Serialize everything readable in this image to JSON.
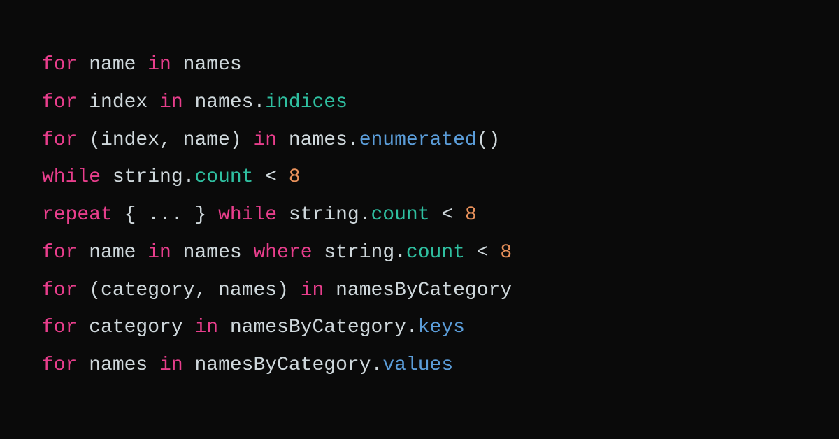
{
  "code": {
    "lines": [
      [
        {
          "cls": "k",
          "t": "for"
        },
        {
          "cls": "d",
          "t": " name "
        },
        {
          "cls": "k",
          "t": "in"
        },
        {
          "cls": "d",
          "t": " names"
        }
      ],
      [
        {
          "cls": "k",
          "t": "for"
        },
        {
          "cls": "d",
          "t": " index "
        },
        {
          "cls": "k",
          "t": "in"
        },
        {
          "cls": "d",
          "t": " names."
        },
        {
          "cls": "p",
          "t": "indices"
        }
      ],
      [
        {
          "cls": "k",
          "t": "for"
        },
        {
          "cls": "d",
          "t": " (index, name) "
        },
        {
          "cls": "k",
          "t": "in"
        },
        {
          "cls": "d",
          "t": " names."
        },
        {
          "cls": "m",
          "t": "enumerated"
        },
        {
          "cls": "d",
          "t": "()"
        }
      ],
      [
        {
          "cls": "k",
          "t": "while"
        },
        {
          "cls": "d",
          "t": " string."
        },
        {
          "cls": "p",
          "t": "count"
        },
        {
          "cls": "d",
          "t": " < "
        },
        {
          "cls": "n",
          "t": "8"
        }
      ],
      [
        {
          "cls": "k",
          "t": "repeat"
        },
        {
          "cls": "d",
          "t": " { ... } "
        },
        {
          "cls": "k",
          "t": "while"
        },
        {
          "cls": "d",
          "t": " string."
        },
        {
          "cls": "p",
          "t": "count"
        },
        {
          "cls": "d",
          "t": " < "
        },
        {
          "cls": "n",
          "t": "8"
        }
      ],
      [
        {
          "cls": "k",
          "t": "for"
        },
        {
          "cls": "d",
          "t": " name "
        },
        {
          "cls": "k",
          "t": "in"
        },
        {
          "cls": "d",
          "t": " names "
        },
        {
          "cls": "k",
          "t": "where"
        },
        {
          "cls": "d",
          "t": " string."
        },
        {
          "cls": "p",
          "t": "count"
        },
        {
          "cls": "d",
          "t": " < "
        },
        {
          "cls": "n",
          "t": "8"
        }
      ],
      [
        {
          "cls": "k",
          "t": "for"
        },
        {
          "cls": "d",
          "t": " (category, names) "
        },
        {
          "cls": "k",
          "t": "in"
        },
        {
          "cls": "d",
          "t": " namesByCategory"
        }
      ],
      [
        {
          "cls": "k",
          "t": "for"
        },
        {
          "cls": "d",
          "t": " category "
        },
        {
          "cls": "k",
          "t": "in"
        },
        {
          "cls": "d",
          "t": " namesByCategory."
        },
        {
          "cls": "m",
          "t": "keys"
        }
      ],
      [
        {
          "cls": "k",
          "t": "for"
        },
        {
          "cls": "d",
          "t": " names "
        },
        {
          "cls": "k",
          "t": "in"
        },
        {
          "cls": "d",
          "t": " namesByCategory."
        },
        {
          "cls": "m",
          "t": "values"
        }
      ]
    ]
  }
}
